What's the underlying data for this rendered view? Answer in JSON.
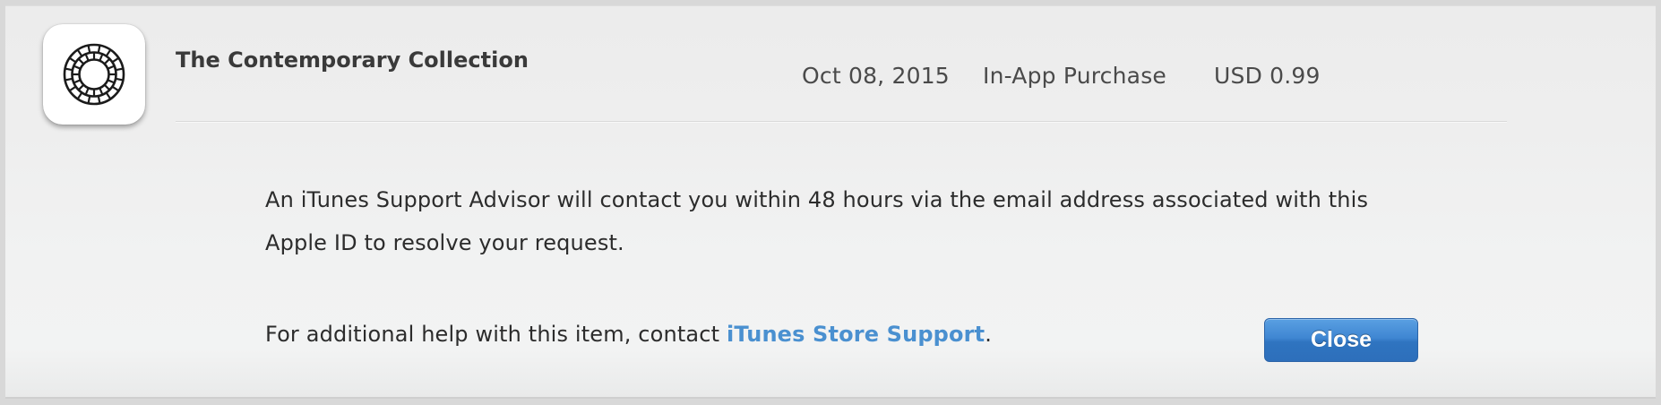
{
  "item": {
    "icon": "vsco-app-icon",
    "title": "The Contemporary Collection",
    "date": "Oct 08, 2015",
    "type": "In-App Purchase",
    "price": "USD 0.99"
  },
  "message": "An iTunes Support Advisor will contact you within 48 hours via the email address associated with this Apple ID to resolve your request.",
  "help": {
    "prefix": "For additional help with this item, contact ",
    "link_label": "iTunes Store Support",
    "suffix": "."
  },
  "buttons": {
    "close_label": "Close"
  },
  "colors": {
    "link": "#4a90d0",
    "button": "#3a80cc"
  }
}
